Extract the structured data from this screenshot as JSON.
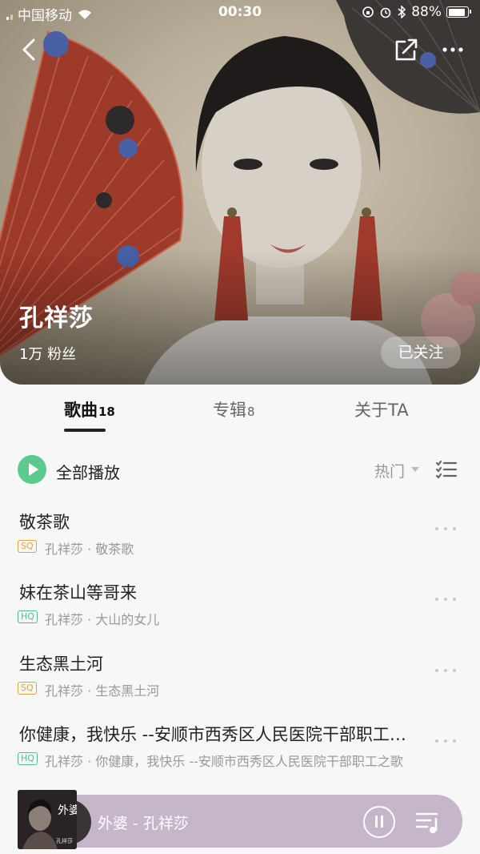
{
  "status_bar": {
    "carrier": "中国移动",
    "time": "00:30",
    "battery": "88%"
  },
  "artist": {
    "name": "孔祥莎",
    "fans": "1万 粉丝",
    "follow_label": "已关注"
  },
  "tabs": [
    {
      "label": "歌曲",
      "count": "18",
      "active": true
    },
    {
      "label": "专辑",
      "count": "8",
      "active": false
    },
    {
      "label": "关于TA",
      "count": "",
      "active": false
    }
  ],
  "toolbar": {
    "play_all_label": "全部播放",
    "sort_label": "热门"
  },
  "songs": [
    {
      "title": "敬茶歌",
      "quality": "SQ",
      "subtitle": "孔祥莎 · 敬茶歌"
    },
    {
      "title": "妹在茶山等哥来",
      "quality": "HQ",
      "subtitle": "孔祥莎 · 大山的女儿"
    },
    {
      "title": "生态黑土河",
      "quality": "SQ",
      "subtitle": "孔祥莎 · 生态黑土河"
    },
    {
      "title": "你健康，我快乐 --安顺市西秀区人民医院干部职工之歌",
      "quality": "HQ",
      "subtitle": "孔祥莎 · 你健康，我快乐 --安顺市西秀区人民医院干部职工之歌"
    }
  ],
  "mini_player": {
    "title": "外婆 - 孔祥莎",
    "cover_text": "外婆",
    "cover_artist": "孔祥莎"
  },
  "colors": {
    "accent": "#5cc98f",
    "sq": "#e0a340",
    "hq": "#4cbf8b",
    "player_bg": "#c5b6c9"
  },
  "icons": [
    "back-icon",
    "share-icon",
    "more-icon",
    "play-icon",
    "sort-caret-icon",
    "list-mode-icon",
    "more-dots-icon",
    "pause-icon",
    "playlist-icon",
    "wifi-icon",
    "bluetooth-icon",
    "alarm-icon",
    "battery-icon"
  ]
}
